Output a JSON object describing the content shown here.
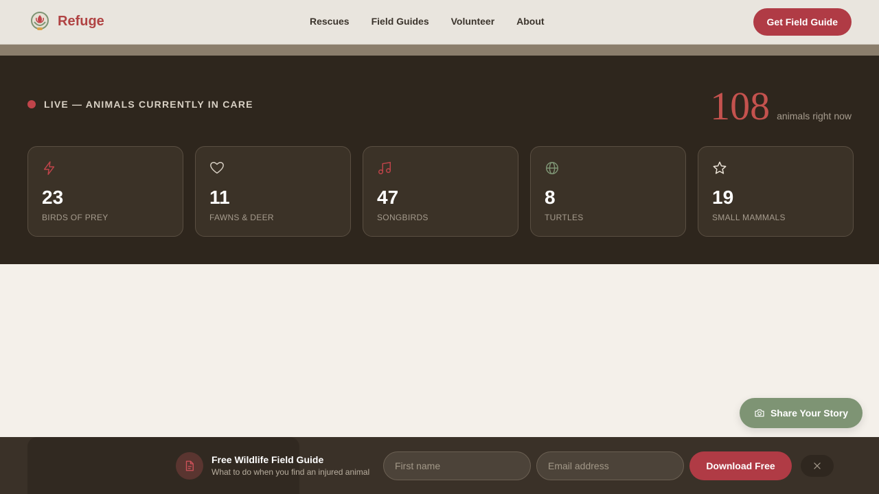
{
  "header": {
    "brand_name": "Refuge",
    "nav": [
      {
        "label": "Rescues"
      },
      {
        "label": "Field Guides"
      },
      {
        "label": "Volunteer"
      },
      {
        "label": "About"
      }
    ],
    "cta_label": "Get Field Guide"
  },
  "live": {
    "label": "LIVE — ANIMALS CURRENTLY IN CARE",
    "total": "108",
    "total_unit": "animals right now",
    "cards": [
      {
        "icon": "lightning-icon",
        "count": "23",
        "label": "BIRDS OF PREY"
      },
      {
        "icon": "heart-icon",
        "count": "11",
        "label": "FAWNS & DEER"
      },
      {
        "icon": "music-note-icon",
        "count": "47",
        "label": "SONGBIRDS"
      },
      {
        "icon": "globe-icon",
        "count": "8",
        "label": "TURTLES"
      },
      {
        "icon": "star-icon",
        "count": "19",
        "label": "SMALL MAMMALS"
      }
    ]
  },
  "story_button": {
    "label": "Share Your Story",
    "icon": "camera-icon"
  },
  "newsletter": {
    "title": "Free Wildlife Field Guide",
    "subtitle": "What to do when you find an injured animal",
    "first_name_placeholder": "First name",
    "email_placeholder": "Email address",
    "submit_label": "Download Free",
    "icon": "document-icon"
  },
  "colors": {
    "accent": "#b03b45",
    "sage": "#7e9474",
    "dark": "#2e261d"
  }
}
